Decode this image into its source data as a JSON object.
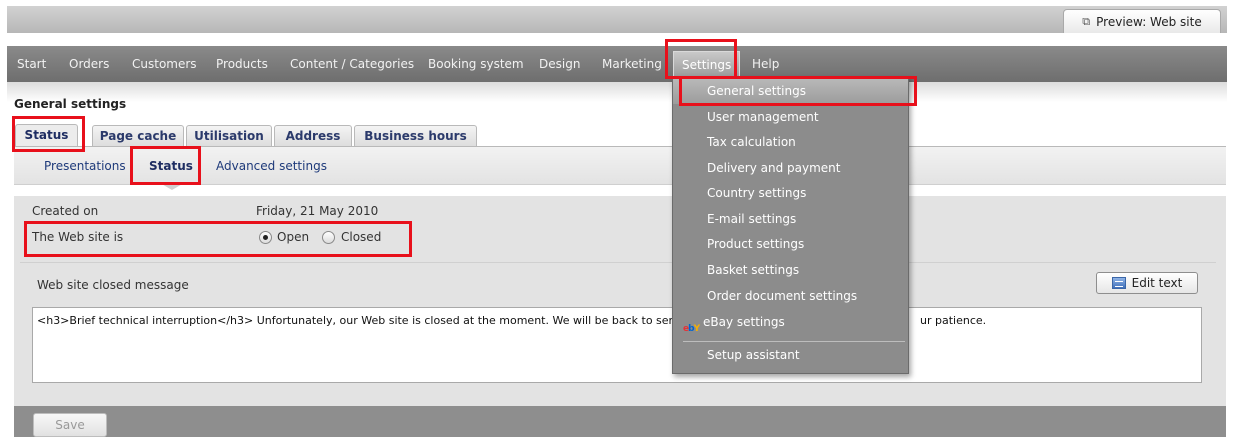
{
  "preview": {
    "label": "Preview: Web site",
    "icon": "external-link-icon"
  },
  "nav": {
    "items": [
      {
        "label": "Start"
      },
      {
        "label": "Orders"
      },
      {
        "label": "Customers"
      },
      {
        "label": "Products"
      },
      {
        "label": "Content / Categories"
      },
      {
        "label": "Booking system"
      },
      {
        "label": "Design"
      },
      {
        "label": "Marketing"
      },
      {
        "label": "Settings",
        "active": true
      },
      {
        "label": "Help"
      }
    ]
  },
  "page": {
    "title": "General settings"
  },
  "tabs": [
    {
      "label": "Status",
      "active": true
    },
    {
      "label": "Page cache"
    },
    {
      "label": "Utilisation"
    },
    {
      "label": "Address"
    },
    {
      "label": "Business hours"
    }
  ],
  "subtabs": [
    {
      "label": "Presentations"
    },
    {
      "label": "Status",
      "active": true
    },
    {
      "label": "Advanced settings"
    }
  ],
  "status": {
    "created_label": "Created on",
    "created_value": "Friday, 21 May 2010",
    "website_label": "The Web site is",
    "options": [
      {
        "label": "Open",
        "checked": true
      },
      {
        "label": "Closed",
        "checked": false
      }
    ]
  },
  "closed_message": {
    "label": "Web site closed message",
    "edit_button": "Edit text",
    "text_left": "<h3>Brief technical interruption</h3> Unfortunately, our Web site is closed at the moment. We will be back to serv",
    "text_right": "ur patience."
  },
  "save_label": "Save",
  "dropdown": {
    "items": [
      {
        "label": "General settings",
        "highlight": true
      },
      {
        "label": "User management"
      },
      {
        "label": "Tax calculation"
      },
      {
        "label": "Delivery and payment"
      },
      {
        "label": "Country settings"
      },
      {
        "label": "E-mail settings"
      },
      {
        "label": "Product settings"
      },
      {
        "label": "Basket settings"
      },
      {
        "label": "Order document settings"
      },
      {
        "label": "eBay settings",
        "icon": "ebay-icon",
        "icon_text": "ebY"
      },
      {
        "label": "Setup assistant"
      }
    ]
  },
  "colors": {
    "highlight_border": "#e8101b",
    "nav_bg": "#7b7b7b",
    "menu_bg": "#8c8c8c",
    "tab_text": "#1e2d62"
  }
}
